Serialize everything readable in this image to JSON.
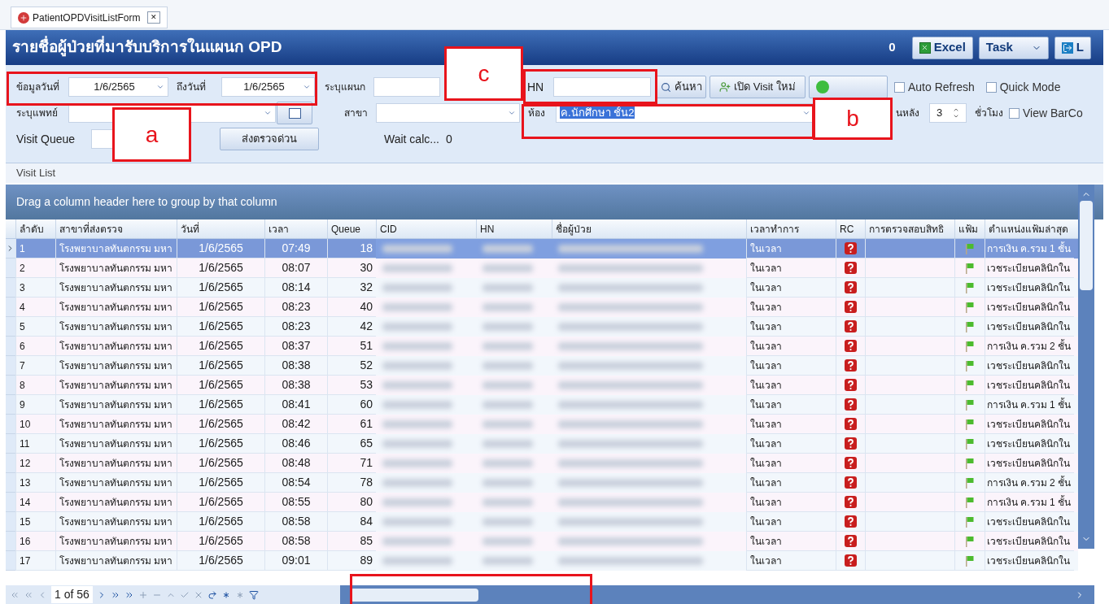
{
  "tab": {
    "title": "PatientOPDVisitListForm",
    "close": "✕"
  },
  "header": {
    "title": "รายชื่อผู้ป่วยที่มารับบริการในแผนก OPD",
    "count": "0",
    "buttons": [
      {
        "label": "Excel",
        "kind": "excel"
      },
      {
        "label": "Task",
        "kind": "dropdown"
      },
      {
        "label": "L",
        "kind": "exit"
      }
    ]
  },
  "filters": {
    "date_from_label": "ข้อมูลวันที่",
    "date_from": "1/6/2565",
    "date_to_label": "ถึงวันที่",
    "date_to": "1/6/2565",
    "department_label": "ระบุแผนก",
    "hn_label": "HN",
    "search_button": "ค้นหา",
    "new_visit_button": "เปิด Visit ใหม่",
    "auto_refresh": {
      "label": "Auto Refresh",
      "checked": false
    },
    "quick_mode": {
      "label": "Quick Mode",
      "checked": false
    },
    "doctor_label": "ระบุแพทย์",
    "branch_label": "สาขา",
    "room_label": "ห้อง",
    "room_value": "ค.นักศึกษา ชั้น2",
    "back_label": "นหลัง",
    "hours_value": "3",
    "hours_label": "ชั่วโมง",
    "view_barcode": {
      "label": "View BarCo",
      "checked": false
    },
    "visit_queue_label": "Visit Queue",
    "urgent_button": "ส่งตรวจด่วน",
    "wait_label": "Wait calc...",
    "wait_value": "0"
  },
  "section_title": "Visit List",
  "group_hint": "Drag a column header here to group by that column",
  "table": {
    "columns": [
      "ลำดับ",
      "สาขาที่ส่งตรวจ",
      "วันที่",
      "เวลา",
      "Queue",
      "CID",
      "HN",
      "ชื่อผู้ป่วย",
      "เวลาทำการ",
      "RC",
      "การตรวจสอบสิทธิ",
      "แฟ้ม",
      "ตำแหน่งแฟ้มล่าสุด"
    ],
    "rows": [
      {
        "no": "1",
        "branch": "โรงพยาบาลทันตกรรม มหา",
        "date": "1/6/2565",
        "time": "07:49",
        "queue": "18",
        "hours": "ในเวลา",
        "location": "การเงิน ค.รวม 1 ชั้น",
        "selected": true
      },
      {
        "no": "2",
        "branch": "โรงพยาบาลทันตกรรม มหา",
        "date": "1/6/2565",
        "time": "08:07",
        "queue": "30",
        "hours": "ในเวลา",
        "location": "เวชระเบียนคลินิกใน",
        "selected": false
      },
      {
        "no": "3",
        "branch": "โรงพยาบาลทันตกรรม มหา",
        "date": "1/6/2565",
        "time": "08:14",
        "queue": "32",
        "hours": "ในเวลา",
        "location": "เวชระเบียนคลินิกใน",
        "selected": false
      },
      {
        "no": "4",
        "branch": "โรงพยาบาลทันตกรรม มหา",
        "date": "1/6/2565",
        "time": "08:23",
        "queue": "40",
        "hours": "ในเวลา",
        "location": "เวชระเบียนคลินิกใน",
        "selected": false
      },
      {
        "no": "5",
        "branch": "โรงพยาบาลทันตกรรม มหา",
        "date": "1/6/2565",
        "time": "08:23",
        "queue": "42",
        "hours": "ในเวลา",
        "location": "เวชระเบียนคลินิกใน",
        "selected": false
      },
      {
        "no": "6",
        "branch": "โรงพยาบาลทันตกรรม มหา",
        "date": "1/6/2565",
        "time": "08:37",
        "queue": "51",
        "hours": "ในเวลา",
        "location": "การเงิน ค.รวม 2 ชั้น",
        "selected": false
      },
      {
        "no": "7",
        "branch": "โรงพยาบาลทันตกรรม มหา",
        "date": "1/6/2565",
        "time": "08:38",
        "queue": "52",
        "hours": "ในเวลา",
        "location": "เวชระเบียนคลินิกใน",
        "selected": false
      },
      {
        "no": "8",
        "branch": "โรงพยาบาลทันตกรรม มหา",
        "date": "1/6/2565",
        "time": "08:38",
        "queue": "53",
        "hours": "ในเวลา",
        "location": "เวชระเบียนคลินิกใน",
        "selected": false
      },
      {
        "no": "9",
        "branch": "โรงพยาบาลทันตกรรม มหา",
        "date": "1/6/2565",
        "time": "08:41",
        "queue": "60",
        "hours": "ในเวลา",
        "location": "การเงิน ค.รวม 1 ชั้น",
        "selected": false
      },
      {
        "no": "10",
        "branch": "โรงพยาบาลทันตกรรม มหา",
        "date": "1/6/2565",
        "time": "08:42",
        "queue": "61",
        "hours": "ในเวลา",
        "location": "เวชระเบียนคลินิกใน",
        "selected": false
      },
      {
        "no": "11",
        "branch": "โรงพยาบาลทันตกรรม มหา",
        "date": "1/6/2565",
        "time": "08:46",
        "queue": "65",
        "hours": "ในเวลา",
        "location": "เวชระเบียนคลินิกใน",
        "selected": false
      },
      {
        "no": "12",
        "branch": "โรงพยาบาลทันตกรรม มหา",
        "date": "1/6/2565",
        "time": "08:48",
        "queue": "71",
        "hours": "ในเวลา",
        "location": "เวชระเบียนคลินิกใน",
        "selected": false
      },
      {
        "no": "13",
        "branch": "โรงพยาบาลทันตกรรม มหา",
        "date": "1/6/2565",
        "time": "08:54",
        "queue": "78",
        "hours": "ในเวลา",
        "location": "การเงิน ค.รวม 2 ชั้น",
        "selected": false
      },
      {
        "no": "14",
        "branch": "โรงพยาบาลทันตกรรม มหา",
        "date": "1/6/2565",
        "time": "08:55",
        "queue": "80",
        "hours": "ในเวลา",
        "location": "การเงิน ค.รวม 1 ชั้น",
        "selected": false
      },
      {
        "no": "15",
        "branch": "โรงพยาบาลทันตกรรม มหา",
        "date": "1/6/2565",
        "time": "08:58",
        "queue": "84",
        "hours": "ในเวลา",
        "location": "เวชระเบียนคลินิกใน",
        "selected": false
      },
      {
        "no": "16",
        "branch": "โรงพยาบาลทันตกรรม มหา",
        "date": "1/6/2565",
        "time": "08:58",
        "queue": "85",
        "hours": "ในเวลา",
        "location": "เวชระเบียนคลินิกใน",
        "selected": false
      },
      {
        "no": "17",
        "branch": "โรงพยาบาลทันตกรรม มหา",
        "date": "1/6/2565",
        "time": "09:01",
        "queue": "89",
        "hours": "ในเวลา",
        "location": "เวชระเบียนคลินิกใน",
        "selected": false
      }
    ]
  },
  "pager": {
    "position": "1 of 56"
  },
  "annotations": [
    {
      "label": "a"
    },
    {
      "label": "b"
    },
    {
      "label": "c"
    }
  ]
}
